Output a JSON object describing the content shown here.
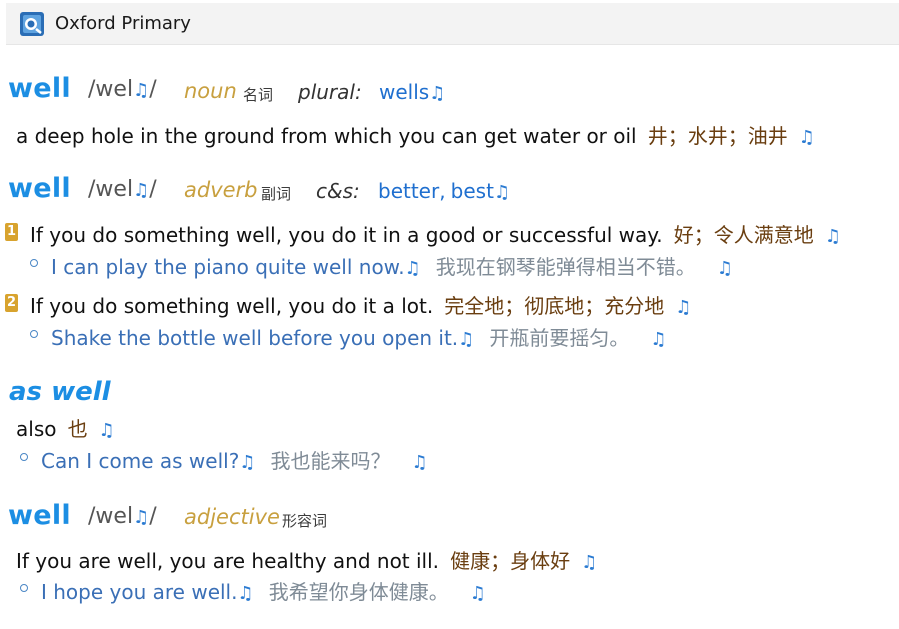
{
  "app": {
    "title": "Oxford Primary"
  },
  "audio_symbol": "♫",
  "entries": [
    {
      "headword": "well",
      "phonetic_open": "/wel",
      "phonetic_close": "/",
      "pos": "noun",
      "pos_zh": "名词",
      "label": "plural:",
      "inflections": "wells",
      "senses": [
        {
          "definition": "a deep hole in the ground from which you can get water or oil",
          "translation": "井；水井；油井"
        }
      ]
    },
    {
      "headword": "well",
      "phonetic_open": "/wel",
      "phonetic_close": "/",
      "pos": "adverb",
      "pos_zh": "副词",
      "label": "c&s:",
      "inflections_a": "better,",
      "inflections_b": "best",
      "senses": [
        {
          "number": "1",
          "definition": "If you do something well, you do it in a good or successful way.",
          "translation": "好；令人满意地",
          "example": "I can play the piano quite well now.",
          "example_zh": "我现在钢琴能弹得相当不错。"
        },
        {
          "number": "2",
          "definition": "If you do something well, you do it a lot.",
          "translation": "完全地；彻底地；充分地",
          "example": "Shake the bottle well before you open it.",
          "example_zh": "开瓶前要摇匀。"
        }
      ]
    },
    {
      "idiom": "as well",
      "definition": "also",
      "translation": "也",
      "example": "Can I come as well?",
      "example_zh": "我也能来吗？"
    },
    {
      "headword": "well",
      "phonetic_open": "/wel",
      "phonetic_close": "/",
      "pos": "adjective",
      "pos_zh": "形容词",
      "senses": [
        {
          "definition": "If you are well, you are healthy and not ill.",
          "translation": "健康；身体好",
          "example": "I hope you are well.",
          "example_zh": "我希望你身体健康。"
        }
      ]
    }
  ],
  "colors": {
    "headword": "#1c8ee3",
    "pos": "#c8a03f",
    "example": "#3a6fb6",
    "translation": "#6a3e10",
    "sense_number": "#d8a32e"
  }
}
